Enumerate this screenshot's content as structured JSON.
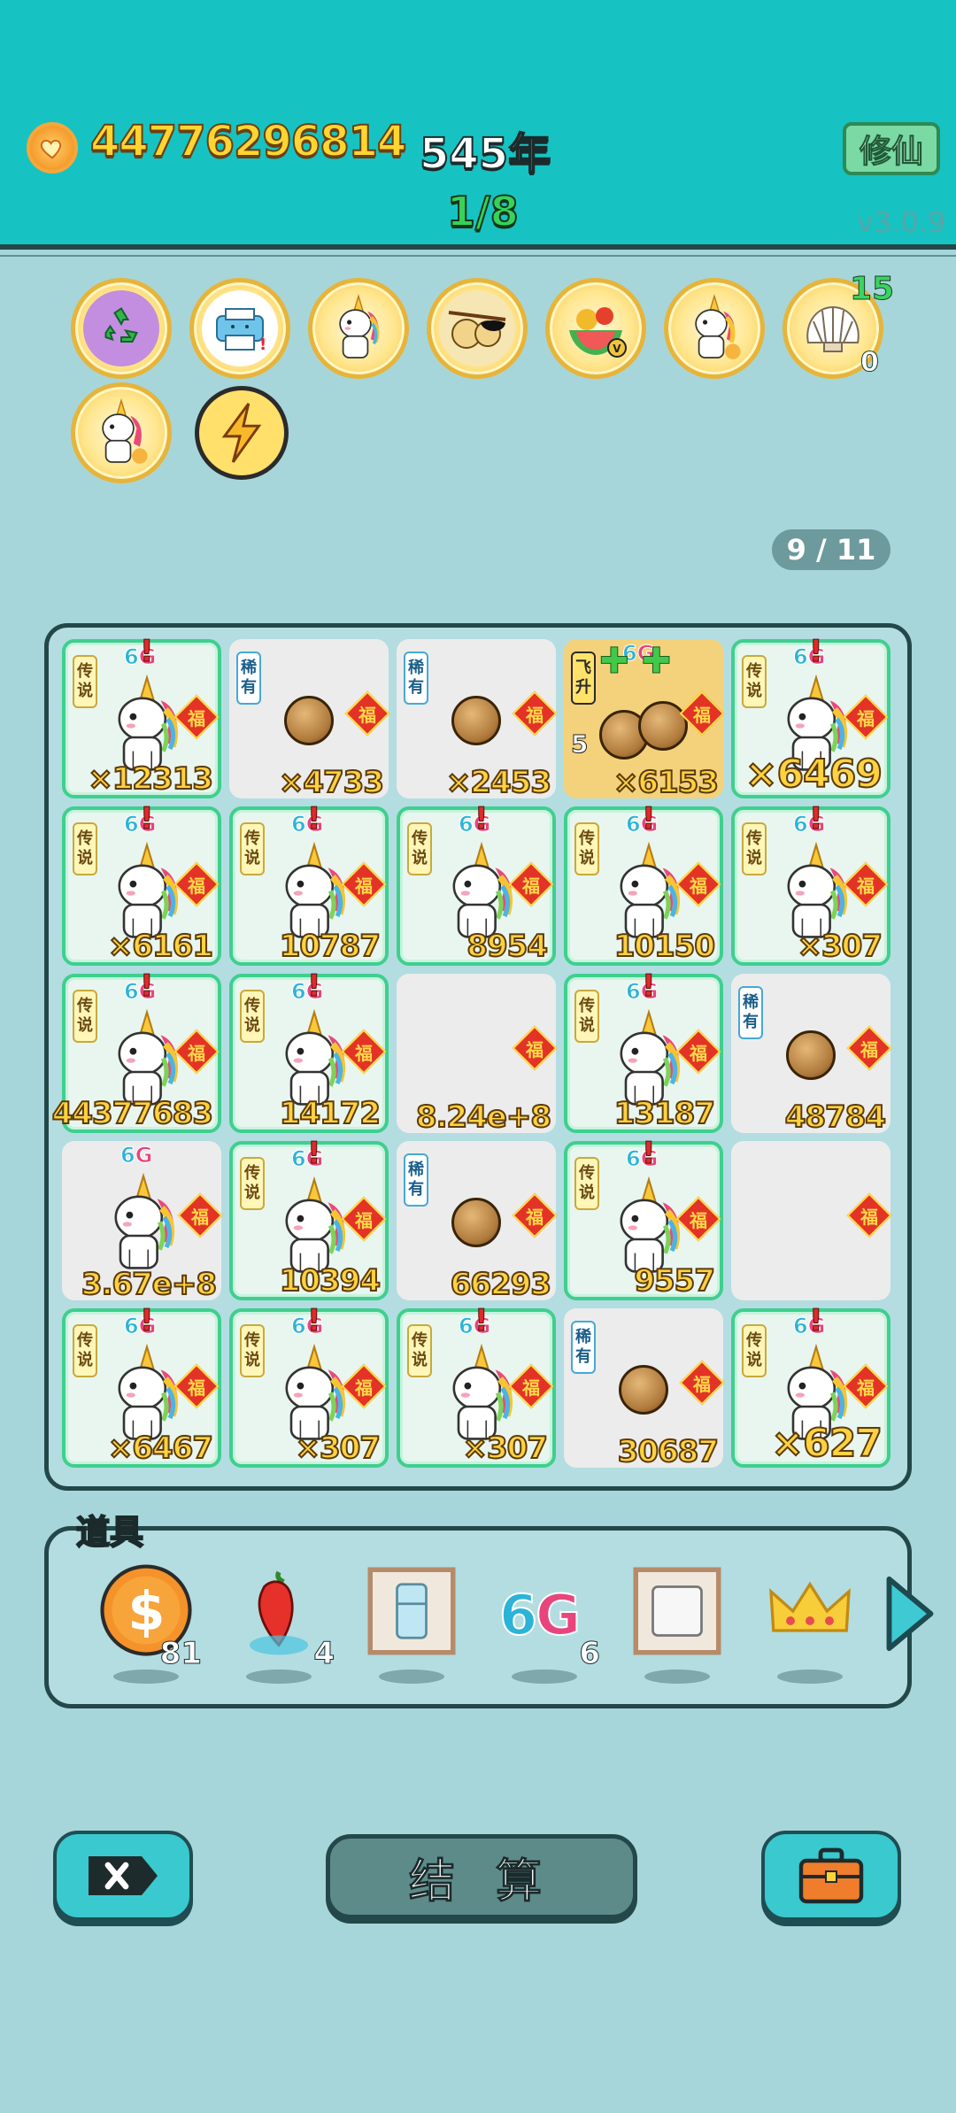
{
  "header": {
    "coins": "44776296814",
    "year": "545年",
    "progress": "1/8",
    "cultivate_button": "修仙",
    "version": "v3.0.9"
  },
  "buffs": {
    "row1": [
      "recycle-icon",
      "printer-icon",
      "unicorn-icon",
      "sunglasses-fruit-icon",
      "fruit-bowl-icon",
      "unicorn-icon",
      "shell-icon"
    ],
    "shell_top": "15",
    "shell_bottom": "0"
  },
  "page_indicator": "9 / 11",
  "board": {
    "cells": [
      {
        "type": "legend",
        "tag": "传说",
        "item": "unicorn",
        "count": "×12313",
        "big": false
      },
      {
        "type": "rare",
        "tag": "稀有",
        "item": "nut",
        "count": "×4733",
        "big": false
      },
      {
        "type": "rare",
        "tag": "稀有",
        "item": "nut",
        "count": "×2453",
        "big": false
      },
      {
        "type": "gold",
        "tag": "飞升",
        "item": "nuts",
        "count": "×6153",
        "level": "5",
        "big": false
      },
      {
        "type": "legend",
        "tag": "传说",
        "item": "unicorn",
        "count": "×6469",
        "big": true
      },
      {
        "type": "legend",
        "tag": "传说",
        "item": "unicorn",
        "count": "×6161",
        "big": false
      },
      {
        "type": "legend",
        "tag": "传说",
        "item": "unicorn",
        "count": "10787",
        "big": false
      },
      {
        "type": "legend",
        "tag": "传说",
        "item": "unicorn",
        "count": "8954",
        "big": false
      },
      {
        "type": "legend",
        "tag": "传说",
        "item": "unicorn",
        "count": "10150",
        "big": false
      },
      {
        "type": "legend",
        "tag": "传说",
        "item": "unicorn",
        "count": "×307",
        "big": false
      },
      {
        "type": "legend",
        "tag": "传说",
        "item": "unicorn",
        "count": "44377683",
        "big": false
      },
      {
        "type": "legend",
        "tag": "传说",
        "item": "unicorn",
        "count": "14172",
        "big": false
      },
      {
        "type": "plain",
        "tag": "",
        "item": "none",
        "count": "8.24e+8",
        "big": false
      },
      {
        "type": "legend",
        "tag": "传说",
        "item": "unicorn",
        "count": "13187",
        "big": false
      },
      {
        "type": "rare",
        "tag": "稀有",
        "item": "nut",
        "count": "48784",
        "big": false
      },
      {
        "type": "plain",
        "tag": "",
        "item": "unicorn",
        "count": "3.67e+8",
        "big": false
      },
      {
        "type": "legend",
        "tag": "传说",
        "item": "unicorn",
        "count": "10394",
        "big": false
      },
      {
        "type": "rare",
        "tag": "稀有",
        "item": "nut",
        "count": "66293",
        "big": false
      },
      {
        "type": "legend",
        "tag": "传说",
        "item": "unicorn",
        "count": "9557",
        "big": false
      },
      {
        "type": "plain",
        "tag": "",
        "item": "none",
        "count": "",
        "big": false
      },
      {
        "type": "legend",
        "tag": "传说",
        "item": "unicorn",
        "count": "×6467",
        "big": false
      },
      {
        "type": "legend",
        "tag": "传说",
        "item": "unicorn",
        "count": "×307",
        "big": false
      },
      {
        "type": "legend",
        "tag": "传说",
        "item": "unicorn",
        "count": "×307",
        "big": false
      },
      {
        "type": "rare",
        "tag": "稀有",
        "item": "nut",
        "count": "30687",
        "big": false
      },
      {
        "type": "legend",
        "tag": "传说",
        "item": "unicorn",
        "count": "×627",
        "big": true
      }
    ],
    "fu_char": "福",
    "sixg_a": "6",
    "sixg_b": "G"
  },
  "tools": {
    "title": "道具",
    "items": [
      {
        "name": "dollar-coin-icon",
        "qty": "81"
      },
      {
        "name": "chili-icon",
        "qty": "4"
      },
      {
        "name": "fridge-frame-icon",
        "qty": ""
      },
      {
        "name": "6g-icon",
        "qty": "6"
      },
      {
        "name": "keyboard-frame-icon",
        "qty": ""
      },
      {
        "name": "crown-icon",
        "qty": ""
      }
    ],
    "sixg_a": "6",
    "sixg_b": "G"
  },
  "actions": {
    "settle_label": "结 算"
  },
  "colors": {
    "header_bg": "#16c3c2",
    "page_bg": "#a6d6da",
    "coin_text": "#ffd531",
    "legend_border": "#3fcf8f"
  }
}
